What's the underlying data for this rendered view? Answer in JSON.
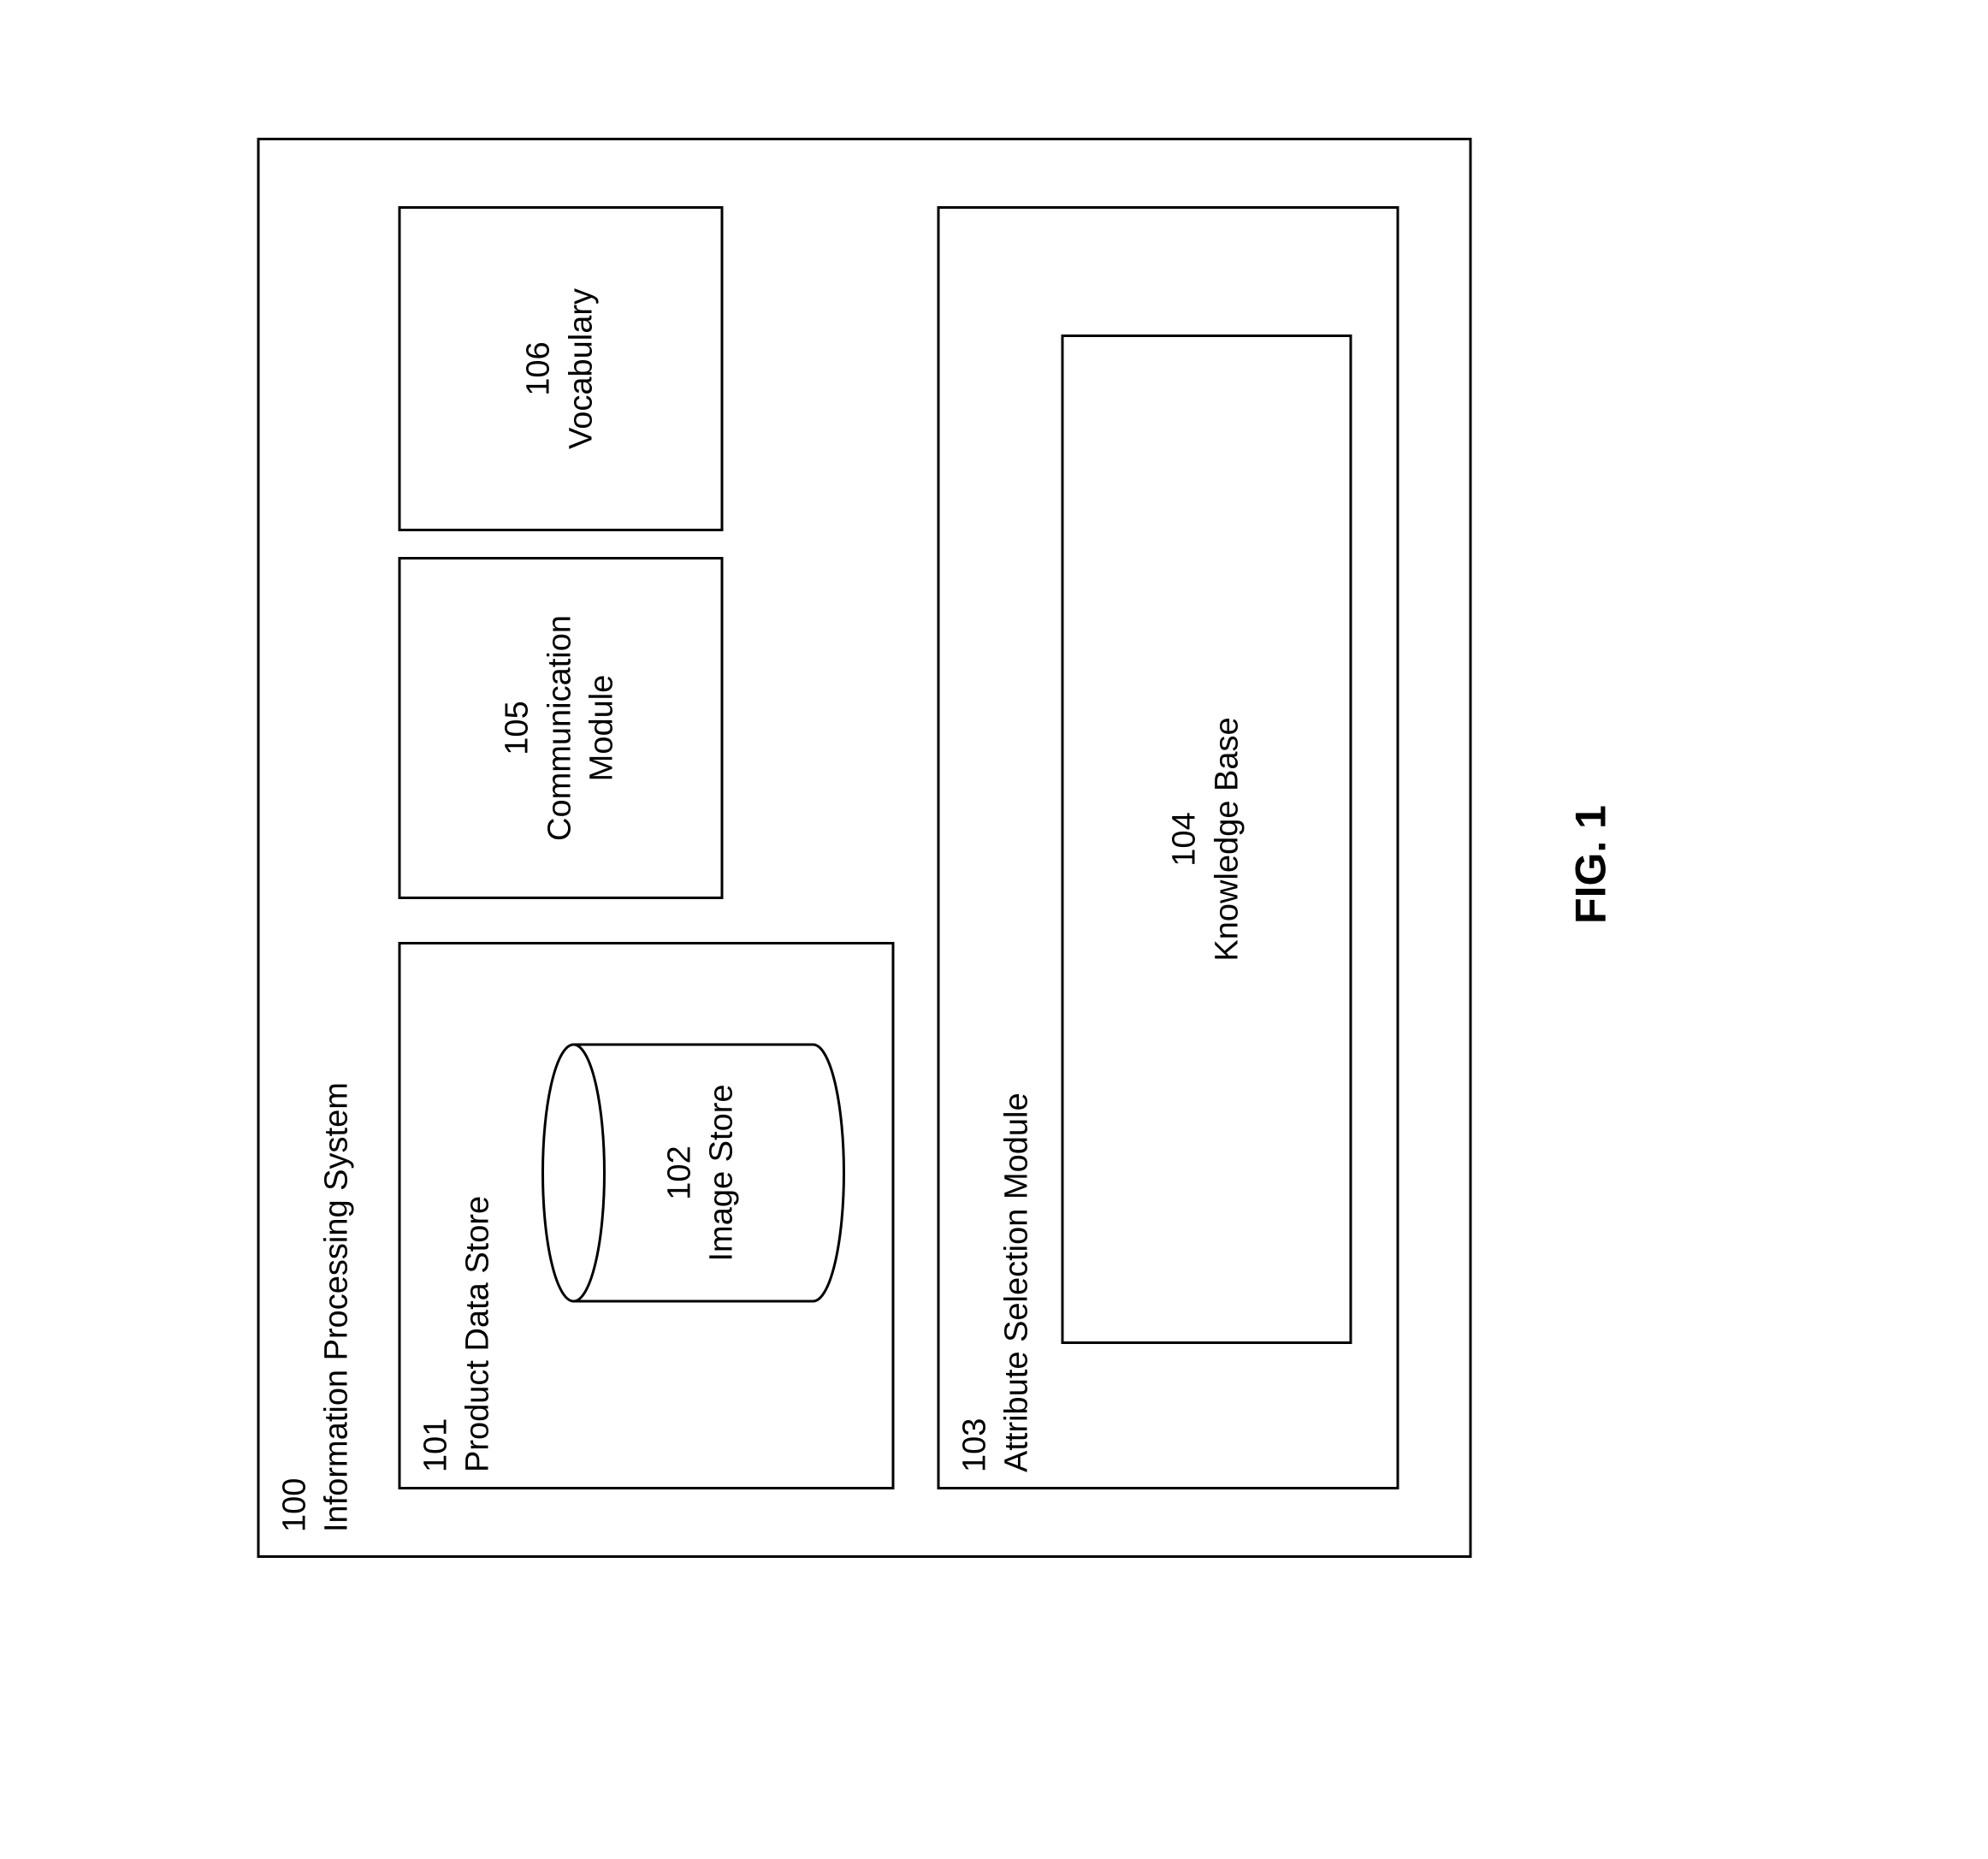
{
  "system": {
    "num": "100",
    "label": "Information Processing System"
  },
  "productDataStore": {
    "num": "101",
    "label": "Product Data Store"
  },
  "imageStore": {
    "num": "102",
    "label": "Image Store"
  },
  "communication": {
    "num": "105",
    "label": "Communication Module"
  },
  "vocabulary": {
    "num": "106",
    "label": "Vocabulary"
  },
  "attributeSelection": {
    "num": "103",
    "label": "Attribute Selection Module"
  },
  "knowledgeBase": {
    "num": "104",
    "label": "Knowledge Base"
  },
  "figureCaption": "FIG. 1"
}
